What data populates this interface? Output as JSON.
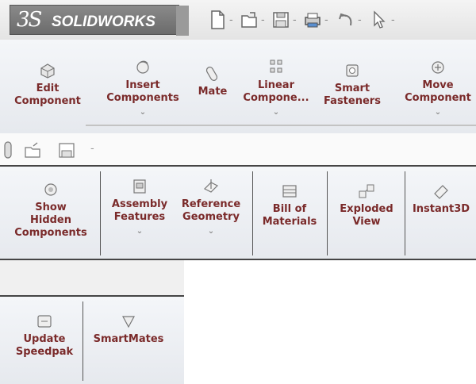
{
  "titlebar": {
    "brand_glyph": "3S",
    "brand_text": "SOLIDWORKS",
    "quick_access": [
      "new-document-icon",
      "open-file-icon",
      "save-icon",
      "print-icon",
      "undo-icon",
      "select-arrow-icon"
    ],
    "dropdown_glyph": "-"
  },
  "commands_row1": {
    "edit_component": "Edit\nComponent",
    "insert_components": "Insert\nComponents",
    "mate": "Mate",
    "linear_component": "Linear\nCompone...",
    "smart_fasteners": "Smart\nFasteners",
    "move_component": "Move\nComponent",
    "dropdown_glyph": "⌄"
  },
  "commands_row3": {
    "show_hidden_components": "Show\nHidden\nComponents",
    "assembly_features": "Assembly\nFeatures",
    "reference_geometry": "Reference\nGeometry",
    "bill_of_materials": "Bill of\nMaterials",
    "exploded_view": "Exploded\nView",
    "instant3d": "Instant3D",
    "dropdown_glyph": "⌄"
  },
  "commands_row5": {
    "update_speedpak": "Update\nSpeedpak",
    "smartmates": "SmartMates"
  },
  "colors": {
    "label": "#7a2a2a",
    "ribbon_bg": "#eef0f4",
    "separator": "#454545"
  }
}
